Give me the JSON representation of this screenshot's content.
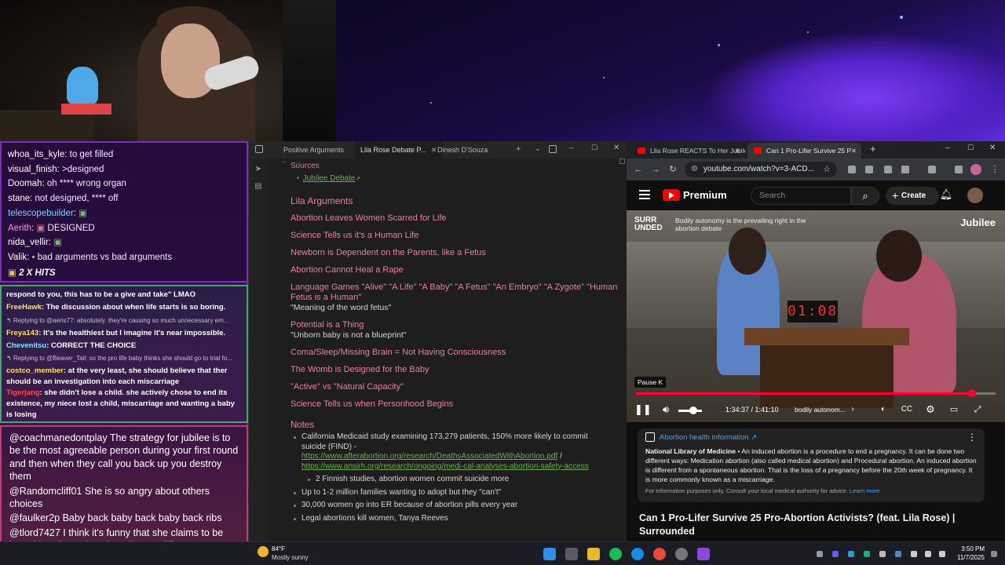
{
  "chat": {
    "section1": [
      {
        "nick": "whoa_its_kyle",
        "text": " to get filled"
      },
      {
        "nick": "visual_finish",
        "text": " >designed"
      },
      {
        "nick": "Doomah",
        "text": " oh **** wrong organ"
      },
      {
        "nick": "stane",
        "text": " not designed, **** off"
      },
      {
        "nick": "telescopebuilder",
        "text": " "
      },
      {
        "nick": "Aerith",
        "text": " DESIGNED"
      },
      {
        "nick": "nida_vellir",
        "text": " "
      },
      {
        "nick": "Valik",
        "text": " bad arguments vs bad arguments"
      }
    ],
    "hits": "2 X HITS",
    "section2": [
      {
        "nick": "",
        "text": "respond to you, this has to be a give and take\" LMAO"
      },
      {
        "nick": "FreeHawk",
        "text": " The discussion about when life starts is so boring."
      },
      {
        "nick": "",
        "text": "Replying to @aeris77: absolutely. they're causing so much unnecessary em..."
      },
      {
        "nick": "Freya143",
        "text": " It's the healthiest but I imagine it's near impossible."
      },
      {
        "nick": "Chevenitsu",
        "text": " CORRECT THE CHOICE"
      },
      {
        "nick": "",
        "text": "Replying to @Beaver_Tail: so the pro life baby thinks she should go to trial fo..."
      },
      {
        "nick": "costco_member",
        "text": " at the very least, she should believe that ther should be an investigation into each miscarriage"
      },
      {
        "nick": "Tigerjang",
        "text": " she didn't lose a child. she actively chose to end its existence, my niece lost a child, miscarriage and wanting a baby is losing"
      }
    ],
    "section3": [
      {
        "nick": "@coachmanedontplay",
        "text": " The strategy for jubilee is to be the most agreeable person during your first round and then when they call you back up you destroy them"
      },
      {
        "nick": "@Randomcliff01",
        "text": " She is so angry about others choices"
      },
      {
        "nick": "@faulker2p",
        "text": " Baby back baby back baby back ribs"
      },
      {
        "nick": "@tlord7427",
        "text": " I think it's funny that she claims to be based in science but she relies on different definitions of what a child means."
      }
    ]
  },
  "notes": {
    "tabs": [
      "Positive Arguments",
      "Lila Rose Debate P...",
      "Dinesh D'Souza"
    ],
    "sources_label": "Sources",
    "source_link": "Jubilee Debate",
    "section_title": "Lila Arguments",
    "arguments": [
      {
        "title": "Abortion Leaves Women Scarred for Life",
        "sub": ""
      },
      {
        "title": "Science Tells us it's a Human Life",
        "sub": ""
      },
      {
        "title": "Newborn is Dependent on the Parents, like a Fetus",
        "sub": ""
      },
      {
        "title": "Abortion Cannot Heal a Rape",
        "sub": ""
      },
      {
        "title": "Language Games \"Alive\" \"A Life\" \"A Baby\" \"A Fetus\" \"An Embryo\" \"A Zygote\" \"Human Fetus is a Human\"",
        "sub": "\"Meaning of the word fetus\""
      },
      {
        "title": "Potential is a Thing",
        "sub": "\"Unborn baby is not a blueprint\""
      },
      {
        "title": "Coma/Sleep/Missing Brain = Not Having Consciousness",
        "sub": ""
      },
      {
        "title": "The Womb is Designed for the Baby",
        "sub": ""
      },
      {
        "title": "\"Active\" vs \"Natural Capacity\"",
        "sub": ""
      },
      {
        "title": "Science Tells us when Personhood Begins",
        "sub": ""
      }
    ],
    "notes_title": "Notes",
    "note1_text": "California Medicaid study examining 173,279 patients, 150% more likely to commit suicide (FIND) - ",
    "note1_link1": "https://www.afterabortion.org/research/DeathsAssociatedWithAbortion.pdf",
    "note1_sep": " / ",
    "note1_link2": "https://www.ansirh.org/research/ongoing/medi-cal-analyses-abortion-safety-access",
    "note2": "2 Finnish studies, abortion women commit suicide more",
    "note3": "Up to 1-2 million families wanting to adopt but they \"can't\"",
    "note4": "30,000 women go into ER because of abortion pills every year",
    "note5": "Legal abortions kill women, Tanya Reeves"
  },
  "yt": {
    "tabs": [
      "Lila Rose REACTS To Her Jubilee",
      "Can 1 Pro-Lifer Survive 25 P"
    ],
    "url": "youtube.com/watch?v=3-ACD...",
    "brand": "Premium",
    "search_placeholder": "Search",
    "create_label": "Create",
    "player": {
      "badge": "SURR UNDED",
      "caption": "Bodily autonomy is the prevailing right in the abortion debate",
      "channel": "Jubilee",
      "clock": "01:08",
      "pause_tip": "Pause  K",
      "time": "1:34:37 / 1:41:10",
      "chapter": "bodily autonom...",
      "progress": 0.935
    },
    "info": {
      "title": "Abortion health information",
      "source": "National Library of Medicine",
      "body": " • An induced abortion is a procedure to end a pregnancy. It can be done two different ways: Medication abortion (also called medical abortion) and Procedural abortion. An induced abortion is different from a spontaneous abortion. That is the loss of a pregnancy before the 20th week of pregnancy. It is more commonly known as a miscarriage.",
      "foot": "For information purposes only. Consult your local medical authority for advice. ",
      "learn_more": "Learn more"
    },
    "video_title": "Can 1 Pro-Lifer Survive 25 Pro-Abortion Activists? (feat. Lila Rose) | Surrounded"
  },
  "taskbar": {
    "temp": "84°F",
    "weather": "Mostly sunny",
    "time": "3:50 PM",
    "date": "11/7/2025"
  }
}
